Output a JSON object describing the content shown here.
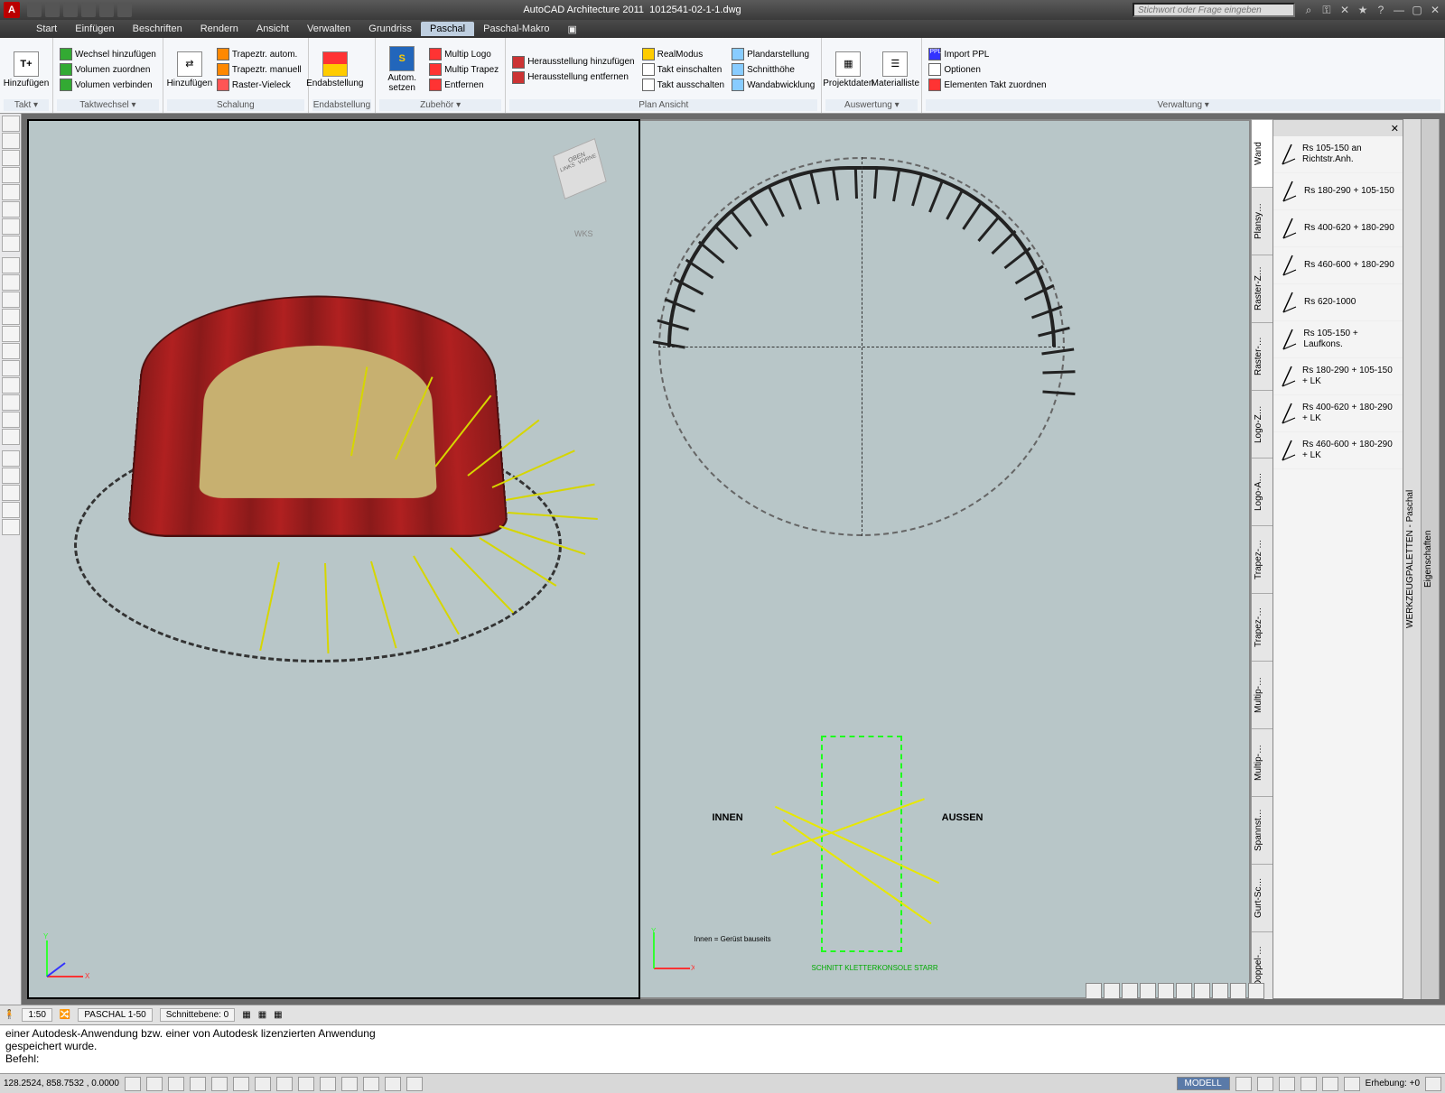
{
  "title": {
    "app": "AutoCAD Architecture 2011",
    "file": "1012541-02-1-1.dwg",
    "search_placeholder": "Stichwort oder Frage eingeben"
  },
  "menus": [
    "Start",
    "Einfügen",
    "Beschriften",
    "Rendern",
    "Ansicht",
    "Verwalten",
    "Grundriss",
    "Paschal",
    "Paschal-Makro"
  ],
  "active_menu": "Paschal",
  "ribbon": {
    "groups": [
      {
        "label": "Takt ▾",
        "big": [
          {
            "icon": "T+",
            "text": "Hinzufügen"
          }
        ],
        "small": []
      },
      {
        "label": "Taktwechsel ▾",
        "big": [],
        "small": [
          "Wechsel hinzufügen",
          "Volumen zuordnen",
          "Volumen verbinden"
        ]
      },
      {
        "label": "Schalung",
        "big": [
          {
            "icon": "⇄",
            "text": "Hinzufügen"
          }
        ],
        "small": [
          "Trapeztr. autom.",
          "Trapeztr. manuell",
          "Raster-Vieleck"
        ]
      },
      {
        "label": "Endabstellung",
        "big": [
          {
            "icon": "▮",
            "text": "Endabstellung"
          }
        ],
        "small": []
      },
      {
        "label": "Zubehör ▾",
        "big": [
          {
            "icon": "S",
            "text": "Autom. setzen"
          }
        ],
        "small": [
          "Multip Logo",
          "Multip Trapez",
          "Entfernen"
        ]
      },
      {
        "label": "Plan Ansicht",
        "big": [],
        "small": [
          "Herausstellung hinzufügen",
          "Herausstellung entfernen",
          "RealModus",
          "Takt einschalten",
          "Takt ausschalten",
          "Plandarstellung",
          "Schnitthöhe",
          "Wandabwicklung"
        ]
      },
      {
        "label": "Auswertung ▾",
        "big": [
          {
            "icon": "▦",
            "text": "Projektdaten"
          },
          {
            "icon": "☰",
            "text": "Materialliste"
          }
        ],
        "small": []
      },
      {
        "label": "Verwaltung ▾",
        "big": [],
        "small": [
          "Import PPL",
          "Optionen",
          "Elementen Takt zuordnen"
        ]
      }
    ]
  },
  "viewcube": {
    "top": "OBEN",
    "left": "LINKS",
    "front": "VORNE",
    "wcs": "WKS"
  },
  "section_labels": {
    "inner": "INNEN",
    "outer": "AUSSEN",
    "caption": "SCHNITT KLETTERKONSOLE STARR",
    "note": "Innen = Gerüst bauseits"
  },
  "vtabs": [
    "Wand",
    "Plansy…",
    "Raster-Z…",
    "Raster-…",
    "Logo-Z…",
    "Logo-A…",
    "Trapez-…",
    "Trapez-…",
    "Multip-…",
    "Multip-…",
    "Spannst…",
    "Gurt-Sc…",
    "Doppel-…"
  ],
  "palette": {
    "title_side": "WERKZEUGPALETTEN - Paschal",
    "props_side": "Eigenschaften",
    "items": [
      "Rs 105-150 an Richtstr.Anh.",
      "Rs 180-290 + 105-150",
      "Rs 400-620 + 180-290",
      "Rs 460-600 + 180-290",
      "Rs 620-1000",
      "Rs 105-150 + Laufkons.",
      "Rs 180-290 + 105-150 + LK",
      "Rs 400-620 + 180-290 + LK",
      "Rs 460-600 + 180-290 + LK"
    ]
  },
  "view_status": {
    "scale": "1:50",
    "layout": "PASCHAL 1-50",
    "schnittebene": "Schnittebene:  0"
  },
  "cmdline": {
    "line1": "einer Autodesk-Anwendung bzw. einer von Autodesk lizenzierten Anwendung",
    "line2": "gespeichert wurde.",
    "line3": "",
    "prompt": "Befehl:"
  },
  "statusbar": {
    "coords": "128.2524, 858.7532 , 0.0000",
    "model": "MODELL",
    "erhebung": "Erhebung: +0"
  }
}
